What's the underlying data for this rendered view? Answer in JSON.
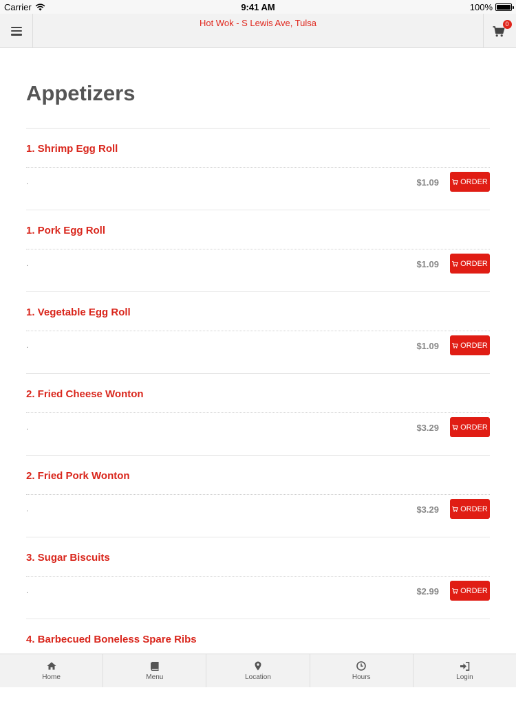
{
  "status_bar": {
    "carrier": "Carrier",
    "time": "9:41 AM",
    "battery": "100%"
  },
  "header": {
    "title": "Hot Wok - S Lewis Ave, Tulsa",
    "cart_count": "0"
  },
  "section": {
    "title": "Appetizers"
  },
  "items": [
    {
      "name": "1. Shrimp Egg Roll",
      "description": ".",
      "price": "$1.09",
      "order_label": "ORDER"
    },
    {
      "name": "1. Pork Egg Roll",
      "description": ".",
      "price": "$1.09",
      "order_label": "ORDER"
    },
    {
      "name": "1. Vegetable Egg Roll",
      "description": ".",
      "price": "$1.09",
      "order_label": "ORDER"
    },
    {
      "name": "2. Fried Cheese Wonton",
      "description": ".",
      "price": "$3.29",
      "order_label": "ORDER"
    },
    {
      "name": "2. Fried Pork Wonton",
      "description": ".",
      "price": "$3.29",
      "order_label": "ORDER"
    },
    {
      "name": "3. Sugar Biscuits",
      "description": ".",
      "price": "$2.99",
      "order_label": "ORDER"
    },
    {
      "name": "4. Barbecued Boneless Spare Ribs",
      "description": "",
      "price": "",
      "order_label": ""
    }
  ],
  "tabs": [
    {
      "label": "Home",
      "icon": "home-icon"
    },
    {
      "label": "Menu",
      "icon": "book-icon"
    },
    {
      "label": "Location",
      "icon": "map-marker-icon"
    },
    {
      "label": "Hours",
      "icon": "clock-icon"
    },
    {
      "label": "Login",
      "icon": "sign-in-icon"
    }
  ],
  "colors": {
    "accent": "#e0251b",
    "heading": "#555555",
    "price": "#888888"
  }
}
